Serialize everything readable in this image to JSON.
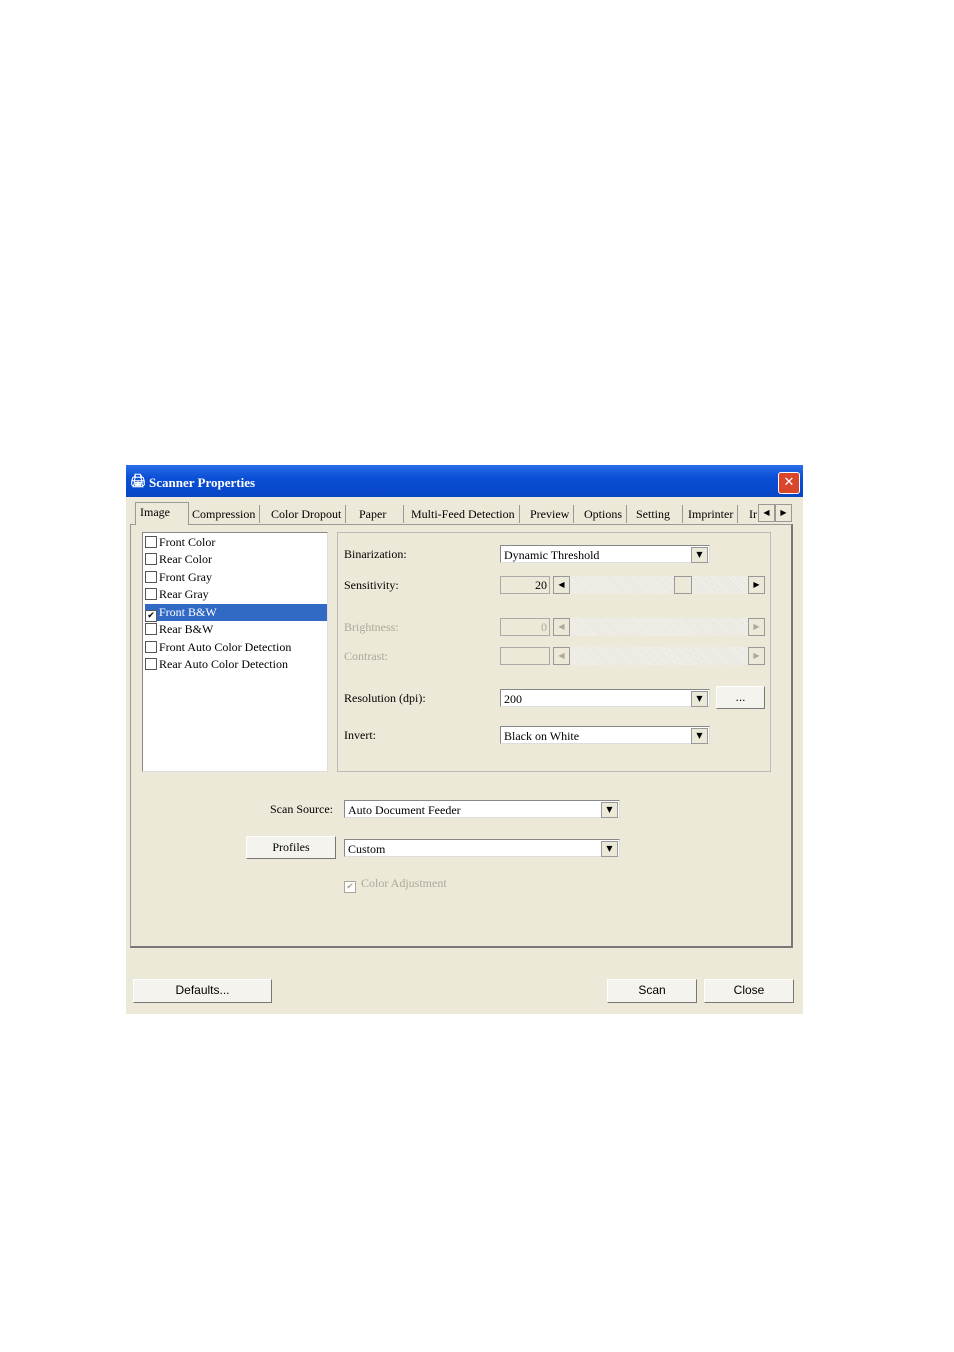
{
  "window": {
    "title": "Scanner Properties",
    "close_icon": "close-icon"
  },
  "tabs": [
    "Image",
    "Compression",
    "Color Dropout",
    "Paper",
    "Multi-Feed Detection",
    "Preview",
    "Options",
    "Setting",
    "Imprinter",
    "Ir"
  ],
  "image_types": [
    {
      "label": "Front Color",
      "checked": false
    },
    {
      "label": "Rear Color",
      "checked": false
    },
    {
      "label": "Front Gray",
      "checked": false
    },
    {
      "label": "Rear Gray",
      "checked": false
    },
    {
      "label": "Front B&W",
      "checked": true,
      "selected": true
    },
    {
      "label": "Rear B&W",
      "checked": false
    },
    {
      "label": "Front Auto Color Detection",
      "checked": false
    },
    {
      "label": "Rear Auto Color Detection",
      "checked": false
    }
  ],
  "settings": {
    "binarization_label": "Binarization:",
    "binarization_value": "Dynamic Threshold",
    "sensitivity_label": "Sensitivity:",
    "sensitivity_value": "20",
    "brightness_label": "Brightness:",
    "brightness_value": "0",
    "contrast_label": "Contrast:",
    "resolution_label": "Resolution (dpi):",
    "resolution_value": "200",
    "resolution_more": "...",
    "invert_label": "Invert:",
    "invert_value": "Black on White"
  },
  "scan_source": {
    "label": "Scan Source:",
    "value": "Auto Document Feeder"
  },
  "profiles": {
    "button": "Profiles",
    "value": "Custom"
  },
  "color_adjustment": {
    "label": "Color Adjustment",
    "checked": true,
    "disabled": true
  },
  "buttons": {
    "defaults": "Defaults...",
    "scan": "Scan",
    "close": "Close"
  },
  "colors": {
    "titlebar": "#0a4fd6",
    "selection": "#316ac5",
    "dialog_bg": "#ece9d8"
  }
}
